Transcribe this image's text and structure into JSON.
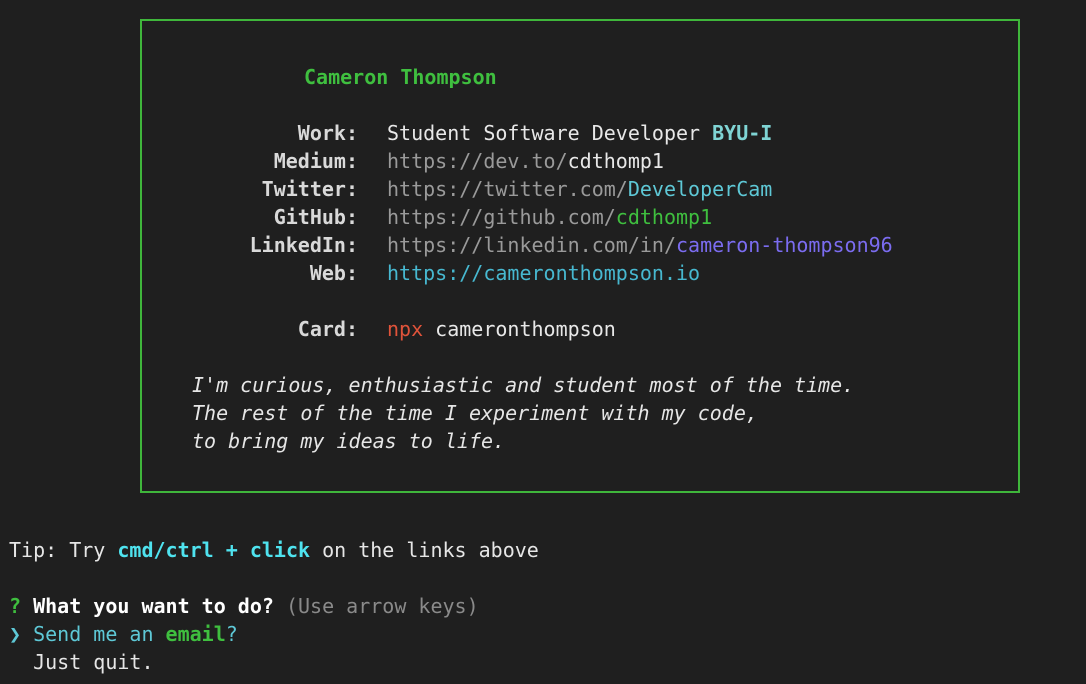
{
  "card": {
    "name": "Cameron Thompson",
    "rows": [
      {
        "label": "Work:",
        "value_a": "Student Software Developer ",
        "value_b": "BYU-I"
      },
      {
        "label": "Medium:",
        "value_a": "https://dev.to/",
        "value_b": "cdthomp1"
      },
      {
        "label": "Twitter:",
        "value_a": "https://twitter.com/",
        "value_b": "DeveloperCam"
      },
      {
        "label": "GitHub:",
        "value_a": "https://github.com/",
        "value_b": "cdthomp1"
      },
      {
        "label": "LinkedIn:",
        "value_a": "https://linkedin.com/in/",
        "value_b": "cameron-thompson96"
      },
      {
        "label": "Web:",
        "value_a": "https://cameronthompson.io",
        "value_b": ""
      }
    ],
    "card_row": {
      "label": "Card:",
      "value_a": "npx",
      "value_b": " cameronthompson"
    },
    "bio": [
      "I'm curious, enthusiastic and student most of the time.",
      "The rest of the time I experiment with my code,",
      "to bring my ideas to life."
    ],
    "border_color": "#3fb63b"
  },
  "tip": {
    "prefix": "Tip: Try ",
    "keys": "cmd/ctrl + click",
    "suffix": " on the links above"
  },
  "prompt": {
    "mark": "?",
    "question": "What you want to do?",
    "hint": "(Use arrow keys)",
    "pointer": "❯",
    "options": [
      {
        "text_a": "Send me an ",
        "text_b": "email",
        "text_c": "?"
      },
      {
        "text_a": "Just quit.",
        "text_b": "",
        "text_c": ""
      }
    ]
  }
}
